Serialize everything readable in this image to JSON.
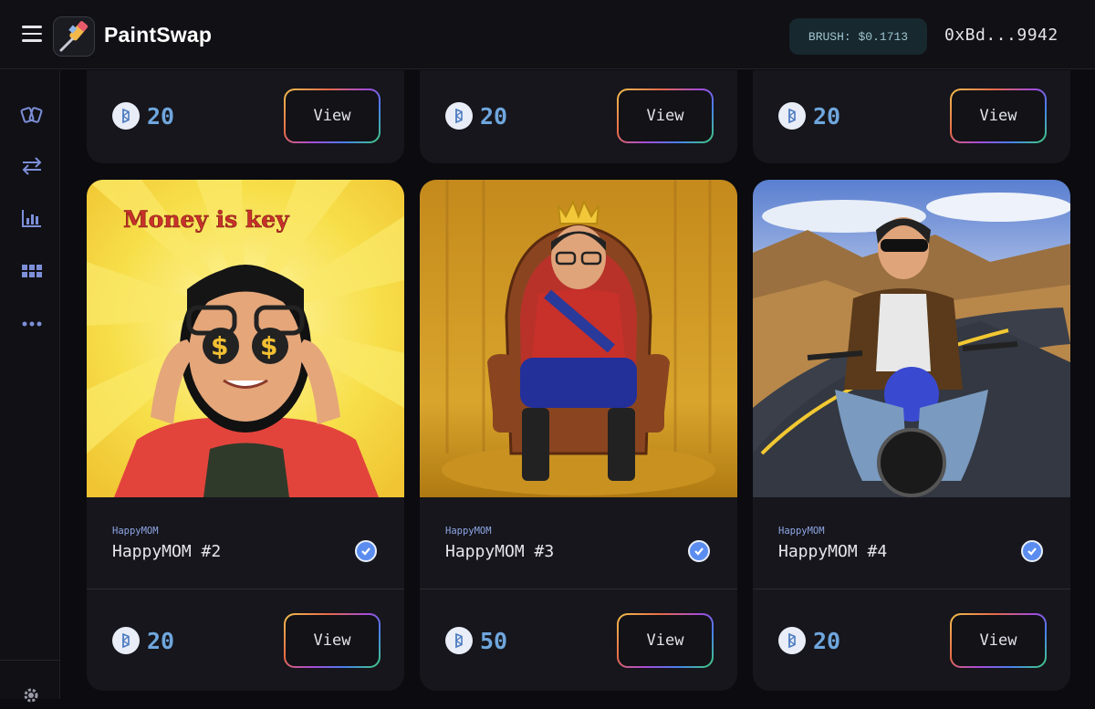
{
  "header": {
    "brand": "PaintSwap",
    "brush_price": "BRUSH: $0.1713",
    "wallet": "0xBd...9942"
  },
  "sidebar": {
    "items": [
      {
        "icon": "cards-icon"
      },
      {
        "icon": "swap-arrows-icon"
      },
      {
        "icon": "bar-chart-icon"
      },
      {
        "icon": "grid-icon"
      },
      {
        "icon": "more-dots-icon"
      }
    ],
    "footer_icon": "settings-icon"
  },
  "top_row": [
    {
      "price": "20",
      "view_label": "View"
    },
    {
      "price": "20",
      "view_label": "View"
    },
    {
      "price": "20",
      "view_label": "View"
    }
  ],
  "cards": [
    {
      "collection": "HappyMOM",
      "name": "HappyMOM #2",
      "price": "20",
      "view_label": "View",
      "art_text": "Money is key"
    },
    {
      "collection": "HappyMOM",
      "name": "HappyMOM #3",
      "price": "50",
      "view_label": "View"
    },
    {
      "collection": "HappyMOM",
      "name": "HappyMOM #4",
      "price": "20",
      "view_label": "View"
    }
  ],
  "colors": {
    "accent_price": "#6fa6dd",
    "verified": "#5b8df0",
    "card_bg": "#16161c"
  }
}
